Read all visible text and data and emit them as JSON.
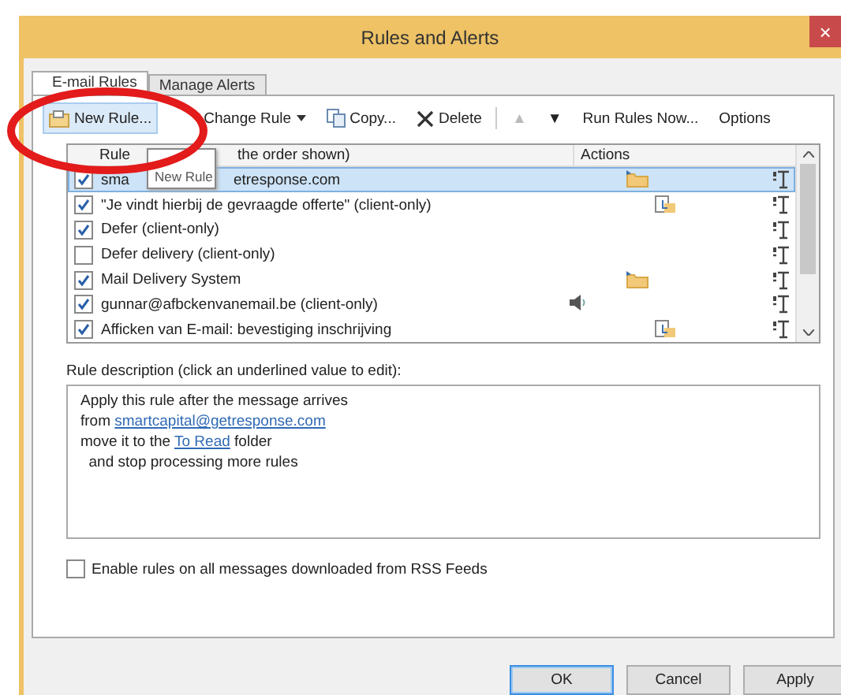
{
  "window": {
    "title": "Rules and Alerts",
    "close": "×"
  },
  "tabs": [
    {
      "label": "E-mail Rules",
      "selected": true
    },
    {
      "label": "Manage Alerts",
      "selected": false
    }
  ],
  "toolbar": [
    {
      "kind": "new",
      "label": "New Rule...",
      "disabled": false
    },
    {
      "kind": "dropdown",
      "label": "Change Rule",
      "disabled": false
    },
    {
      "kind": "copy",
      "label": "Copy...",
      "disabled": false
    },
    {
      "kind": "delete",
      "label": "Delete",
      "disabled": false
    },
    {
      "kind": "up",
      "label": "▲",
      "disabled": true
    },
    {
      "kind": "down",
      "label": "▼",
      "disabled": false
    },
    {
      "kind": "text",
      "label": "Run Rules Now...",
      "disabled": false
    },
    {
      "kind": "text",
      "label": "Options",
      "disabled": false
    }
  ],
  "tooltip": "New Rule",
  "rules": {
    "columns": [
      {
        "label": "Rule",
        "tail": "the order shown)"
      },
      {
        "label": "Actions"
      }
    ],
    "rows": [
      {
        "name": "sma",
        "name_tail": "etresponse.com",
        "checked": true,
        "selected": true,
        "kind": "move"
      },
      {
        "name": "\"Je vindt hierbij de gevraagde offerte\"   (client-only)",
        "checked": true,
        "selected": false,
        "kind": "copy"
      },
      {
        "name": "Defer  (client-only)",
        "checked": true,
        "selected": false,
        "kind": "plain"
      },
      {
        "name": "Defer delivery  (client-only)",
        "checked": false,
        "selected": false,
        "kind": "plain"
      },
      {
        "name": "Mail Delivery System",
        "checked": true,
        "selected": false,
        "kind": "move"
      },
      {
        "name": "gunnar@afbckenvanemail.be  (client-only)",
        "checked": true,
        "selected": false,
        "kind": "sound"
      },
      {
        "name": "Afficken van E-mail: bevestiging inschrijving",
        "checked": true,
        "selected": false,
        "kind": "copy"
      }
    ]
  },
  "description": {
    "label": "Rule description (click an underlined value to edit):",
    "lines": [
      [
        {
          "text": "Apply this rule after the message arrives"
        }
      ],
      [
        {
          "text": "from "
        },
        {
          "text": "smartcapital@getresponse.com",
          "link": true
        }
      ],
      [
        {
          "text": "move it to the "
        },
        {
          "text": "To Read",
          "link": true
        },
        {
          "text": " folder"
        }
      ],
      [
        {
          "text": "  and stop processing more rules"
        }
      ]
    ]
  },
  "rss_option": {
    "label": "Enable rules on all messages downloaded from RSS Feeds",
    "checked": false
  },
  "buttons": [
    {
      "label": "OK",
      "default": true
    },
    {
      "label": "Cancel",
      "default": false
    },
    {
      "label": "Apply",
      "default": false
    }
  ]
}
